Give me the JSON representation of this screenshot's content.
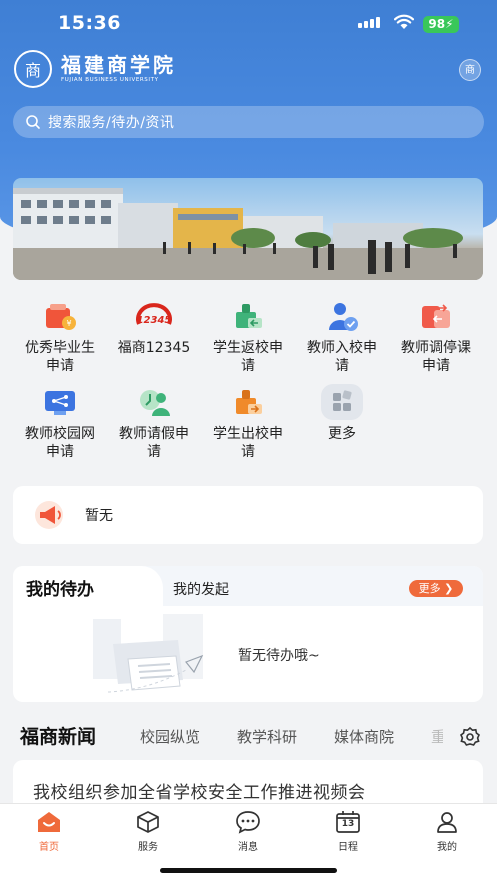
{
  "status_bar": {
    "time": "15:36",
    "battery": "98"
  },
  "header": {
    "logo_cn": "福建商学院",
    "logo_en": "FUJIAN BUSINESS UNIVERSITY",
    "emblem_char": "商",
    "badge_char": "商"
  },
  "search": {
    "placeholder": "搜索服务/待办/资讯"
  },
  "services": [
    {
      "label": "优秀毕业生申请",
      "icon": "graduate-award-icon",
      "color": "#f0553a"
    },
    {
      "label": "福商12345",
      "icon": "hotline-12345-icon",
      "color": "#d9261c"
    },
    {
      "label": "学生返校申请",
      "icon": "student-return-icon",
      "color": "#3fb37a"
    },
    {
      "label": "教师入校申请",
      "icon": "teacher-entry-icon",
      "color": "#3c74e0"
    },
    {
      "label": "教师调停课申请",
      "icon": "class-reschedule-icon",
      "color": "#f05a4a"
    },
    {
      "label": "教师校园网申请",
      "icon": "campus-network-icon",
      "color": "#3c74e0"
    },
    {
      "label": "教师请假申请",
      "icon": "teacher-leave-icon",
      "color": "#3fb37a"
    },
    {
      "label": "学生出校申请",
      "icon": "student-exit-icon",
      "color": "#f08a2a"
    },
    {
      "label": "更多",
      "icon": "more-apps-icon",
      "color": "#d7dde6"
    }
  ],
  "notice": {
    "text": "暂无"
  },
  "todo": {
    "tab_active": "我的待办",
    "tab_other": "我的发起",
    "more_label": "更多",
    "empty_text": "暂无待办哦~"
  },
  "news": {
    "title": "福商新闻",
    "tabs": [
      "校园纵览",
      "教学科研",
      "媒体商院",
      "重"
    ],
    "first_headline": "我校组织参加全省学校安全工作推进视频会"
  },
  "tabbar": [
    {
      "label": "首页",
      "icon": "home-icon",
      "active": true
    },
    {
      "label": "服务",
      "icon": "cube-icon",
      "active": false
    },
    {
      "label": "消息",
      "icon": "message-icon",
      "active": false
    },
    {
      "label": "日程",
      "icon": "calendar-icon",
      "active": false,
      "date": "13"
    },
    {
      "label": "我的",
      "icon": "user-icon",
      "active": false
    }
  ],
  "colors": {
    "primary": "#4a8ae0",
    "accent": "#ef6a3b",
    "active_tab": "#ef6a3b"
  }
}
